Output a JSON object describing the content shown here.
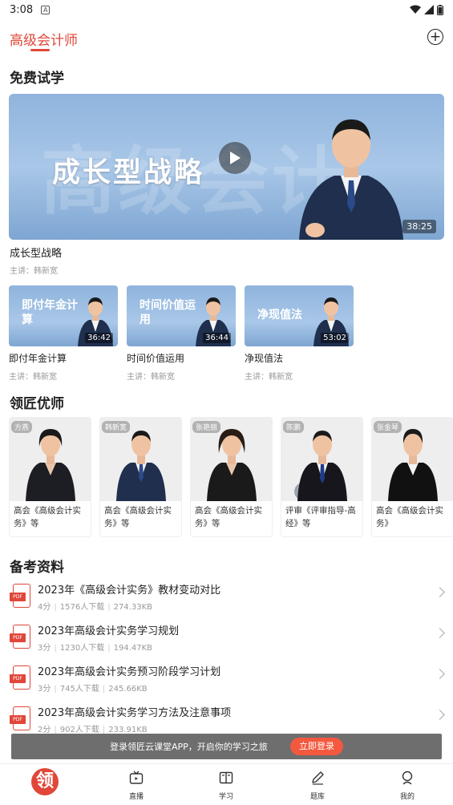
{
  "status": {
    "time": "3:08",
    "badge": "A"
  },
  "header": {
    "title": "高级会计师"
  },
  "sections": {
    "free_trial": "免费试学",
    "teachers": "领匠优师",
    "materials": "备考资料"
  },
  "hero": {
    "title": "成长型战略",
    "bg_text": "高级会计",
    "duration": "38:25",
    "caption": "成长型战略",
    "sub": "主讲：韩新宽"
  },
  "videos": [
    {
      "thumb_title": "即付年金计算",
      "duration": "36:42",
      "caption": "即付年金计算",
      "sub": "主讲：韩新宽"
    },
    {
      "thumb_title": "时间价值运用",
      "duration": "36:44",
      "caption": "时间价值运用",
      "sub": "主讲：韩新宽"
    },
    {
      "thumb_title": "净现值法",
      "duration": "53:02",
      "caption": "净现值法",
      "sub": "主讲：韩新宽"
    }
  ],
  "teachers": [
    {
      "name": "方燕",
      "desc": "高会《高级会计实务》等",
      "gender": "f",
      "suit": "#1d1d24"
    },
    {
      "name": "韩新宽",
      "desc": "高会《高级会计实务》等",
      "gender": "m",
      "suit": "#1f2f4d"
    },
    {
      "name": "张艳丽",
      "desc": "高会《高级会计实务》等",
      "gender": "f",
      "suit": "#1a1a1a"
    },
    {
      "name": "陈鹏",
      "desc": "评审《评审指导-高经》等",
      "gender": "m",
      "suit": "#16161c"
    },
    {
      "name": "张金琴",
      "desc": "高会《高级会计实务》",
      "gender": "f",
      "suit": "#111111"
    }
  ],
  "materials": [
    {
      "name": "2023年《高级会计实务》教材变动对比",
      "score": "4分",
      "downloads": "1576人下载",
      "size": "274.33KB"
    },
    {
      "name": "2023年高级会计实务学习规划",
      "score": "3分",
      "downloads": "1230人下载",
      "size": "194.47KB"
    },
    {
      "name": "2023年高级会计实务预习阶段学习计划",
      "score": "3分",
      "downloads": "745人下载",
      "size": "245.66KB"
    },
    {
      "name": "2023年高级会计实务学习方法及注意事项",
      "score": "2分",
      "downloads": "902人下载",
      "size": "233.91KB"
    }
  ],
  "pdf_label": "PDF",
  "login_bar": {
    "message": "登录领匠云课堂APP，开启你的学习之旅",
    "button": "立即登录"
  },
  "tabbar": {
    "home_logo": "领",
    "items": [
      {
        "label": "直播",
        "icon": "tv-icon"
      },
      {
        "label": "学习",
        "icon": "book-icon"
      },
      {
        "label": "题库",
        "icon": "pen-icon"
      },
      {
        "label": "我的",
        "icon": "user-icon"
      }
    ]
  },
  "colors": {
    "accent": "#e0473a",
    "login_button": "#f4583e"
  }
}
